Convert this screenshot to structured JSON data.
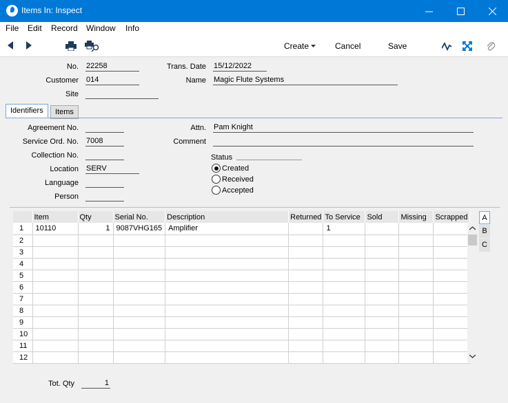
{
  "window": {
    "title": "Items In: Inspect"
  },
  "menu": [
    "File",
    "Edit",
    "Record",
    "Window",
    "Info"
  ],
  "toolbar": {
    "create": "Create",
    "cancel": "Cancel",
    "save": "Save"
  },
  "header": {
    "no_label": "No.",
    "no": "22258",
    "customer_label": "Customer",
    "customer": "014",
    "site_label": "Site",
    "site": "",
    "transdate_label": "Trans. Date",
    "transdate": "15/12/2022",
    "name_label": "Name",
    "name": "Magic Flute Systems"
  },
  "tabs": [
    "Identifiers",
    "Items"
  ],
  "identifiers": {
    "agreement_label": "Agreement No.",
    "agreement": "",
    "serviceord_label": "Service Ord. No.",
    "serviceord": "7008",
    "collection_label": "Collection No.",
    "collection": "",
    "location_label": "Location",
    "location": "SERV",
    "language_label": "Language",
    "language": "",
    "person_label": "Person",
    "person": "",
    "attn_label": "Attn.",
    "attn": "Pam Knight",
    "comment_label": "Comment",
    "comment": "",
    "status_label": "Status",
    "status_options": [
      "Created",
      "Received",
      "Accepted"
    ],
    "status_selected": "Created"
  },
  "grid": {
    "columns": [
      "",
      "Item",
      "Qty",
      "Serial No.",
      "Description",
      "Returned",
      "To Service",
      "Sold",
      "Missing",
      "Scrapped"
    ],
    "rows": [
      [
        "1",
        "10110",
        "1",
        "9087VHG165",
        "Amplifier",
        "",
        "1",
        "",
        "",
        ""
      ],
      [
        "2",
        "",
        "",
        "",
        "",
        "",
        "",
        "",
        "",
        ""
      ],
      [
        "3",
        "",
        "",
        "",
        "",
        "",
        "",
        "",
        "",
        ""
      ],
      [
        "4",
        "",
        "",
        "",
        "",
        "",
        "",
        "",
        "",
        ""
      ],
      [
        "5",
        "",
        "",
        "",
        "",
        "",
        "",
        "",
        "",
        ""
      ],
      [
        "6",
        "",
        "",
        "",
        "",
        "",
        "",
        "",
        "",
        ""
      ],
      [
        "7",
        "",
        "",
        "",
        "",
        "",
        "",
        "",
        "",
        ""
      ],
      [
        "8",
        "",
        "",
        "",
        "",
        "",
        "",
        "",
        "",
        ""
      ],
      [
        "9",
        "",
        "",
        "",
        "",
        "",
        "",
        "",
        "",
        ""
      ],
      [
        "10",
        "",
        "",
        "",
        "",
        "",
        "",
        "",
        "",
        ""
      ],
      [
        "11",
        "",
        "",
        "",
        "",
        "",
        "",
        "",
        "",
        ""
      ],
      [
        "12",
        "",
        "",
        "",
        "",
        "",
        "",
        "",
        "",
        ""
      ]
    ]
  },
  "sidetabs": [
    "A",
    "B",
    "C"
  ],
  "footer": {
    "totqty_label": "Tot. Qty",
    "totqty": "1"
  }
}
